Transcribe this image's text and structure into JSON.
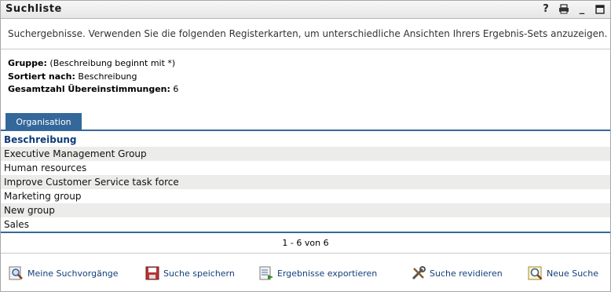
{
  "window": {
    "title": "Suchliste"
  },
  "toolbar_icons": {
    "help": "?",
    "print": "print-icon",
    "minimize": "_",
    "maximize": "maximize-icon"
  },
  "description": "Suchergebnisse. Verwenden Sie die folgenden Registerkarten, um unterschiedliche Ansichten Ihrers Ergebnis-Sets anzuzeigen.",
  "info": {
    "group_label": "Gruppe:",
    "group_value": "(Beschreibung beginnt mit *)",
    "sorted_label": "Sortiert nach:",
    "sorted_value": "Beschreibung",
    "total_label": "Gesamtzahl Übereinstimmungen:",
    "total_value": "6"
  },
  "tab": {
    "label": "Organisation"
  },
  "table": {
    "header": "Beschreibung",
    "rows": [
      "Executive Management Group",
      "Human resources",
      "Improve Customer Service task force",
      "Marketing group",
      "New group",
      "Sales"
    ]
  },
  "pager": "1 - 6 von 6",
  "actions": {
    "my_searches": "Meine Suchvorgänge",
    "save_search": "Suche speichern",
    "export_results": "Ergebnisse exportieren",
    "revise_search": "Suche revidieren",
    "new_search": "Neue Suche"
  },
  "colors": {
    "accent": "#35689a",
    "header_text": "#0e3c7a",
    "link": "#123f7a",
    "alt_row": "#ececea"
  }
}
